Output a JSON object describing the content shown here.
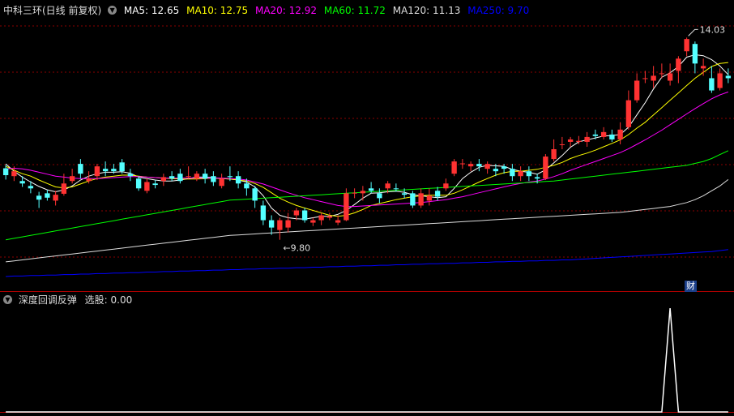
{
  "header": {
    "title": "中科三环(日线 前复权)",
    "ma": [
      {
        "label": "MA5: 12.65",
        "color": "#ffffff"
      },
      {
        "label": "MA10: 12.75",
        "color": "#ffff00"
      },
      {
        "label": "MA20: 12.92",
        "color": "#ff00ff"
      },
      {
        "label": "MA60: 11.72",
        "color": "#00ff00"
      },
      {
        "label": "MA120: 11.13",
        "color": "#dddddd"
      },
      {
        "label": "MA250: 9.70",
        "color": "#0000ff"
      }
    ]
  },
  "indicator": {
    "title": "深度回调反弹",
    "value_label": "选股: 0.00",
    "finance_badge": "财"
  },
  "colors": {
    "up": "#ff3232",
    "down": "#54ffff",
    "grid": "#8b0000"
  },
  "chart_data": {
    "type": "candlestick",
    "annotations": {
      "high_label": "14.03",
      "low_label": "9.80"
    },
    "ylim": [
      9.1,
      14.4
    ],
    "candles": [
      [
        11.36,
        11.22,
        11.43,
        11.13
      ],
      [
        11.2,
        11.3,
        11.4,
        11.1
      ],
      [
        11.1,
        11.05,
        11.2,
        10.98
      ],
      [
        11.0,
        10.95,
        11.1,
        10.85
      ],
      [
        10.8,
        10.72,
        10.88,
        10.55
      ],
      [
        10.85,
        10.76,
        10.92,
        10.7
      ],
      [
        10.7,
        10.82,
        10.9,
        10.6
      ],
      [
        10.84,
        11.05,
        11.25,
        10.8
      ],
      [
        11.1,
        11.2,
        11.35,
        11.05
      ],
      [
        11.45,
        11.25,
        11.55,
        11.15
      ],
      [
        11.1,
        11.15,
        11.3,
        11.05
      ],
      [
        11.2,
        11.4,
        11.45,
        11.12
      ],
      [
        11.35,
        11.3,
        11.5,
        11.2
      ],
      [
        11.35,
        11.3,
        11.45,
        11.25
      ],
      [
        11.48,
        11.3,
        11.55,
        11.25
      ],
      [
        11.25,
        11.2,
        11.35,
        11.1
      ],
      [
        11.15,
        10.95,
        11.2,
        10.9
      ],
      [
        10.9,
        11.08,
        11.15,
        10.85
      ],
      [
        11.05,
        11.02,
        11.12,
        10.95
      ],
      [
        11.1,
        11.18,
        11.25,
        11.0
      ],
      [
        11.2,
        11.15,
        11.3,
        11.1
      ],
      [
        11.25,
        11.1,
        11.35,
        11.05
      ],
      [
        11.2,
        11.2,
        11.4,
        11.15
      ],
      [
        11.15,
        11.25,
        11.3,
        11.1
      ],
      [
        11.25,
        11.15,
        11.35,
        11.05
      ],
      [
        11.2,
        11.08,
        11.3,
        11.0
      ],
      [
        11.0,
        11.15,
        11.25,
        10.95
      ],
      [
        11.2,
        11.18,
        11.4,
        11.1
      ],
      [
        11.2,
        11.05,
        11.3,
        10.95
      ],
      [
        11.05,
        10.95,
        11.15,
        10.8
      ],
      [
        10.95,
        10.7,
        11.0,
        10.55
      ],
      [
        10.6,
        10.3,
        10.7,
        10.2
      ],
      [
        10.3,
        10.15,
        10.4,
        10.0
      ],
      [
        10.1,
        10.3,
        10.35,
        9.9
      ],
      [
        10.15,
        10.3,
        10.45,
        10.05
      ],
      [
        10.4,
        10.5,
        10.55,
        10.3
      ],
      [
        10.5,
        10.3,
        10.55,
        10.25
      ],
      [
        10.25,
        10.3,
        10.35,
        10.18
      ],
      [
        10.3,
        10.4,
        10.45,
        10.2
      ],
      [
        10.35,
        10.38,
        10.45,
        10.3
      ],
      [
        10.25,
        10.3,
        10.4,
        10.2
      ],
      [
        10.3,
        10.85,
        10.95,
        10.28
      ],
      [
        10.85,
        10.86,
        10.95,
        10.75
      ],
      [
        10.85,
        10.9,
        11.0,
        10.7
      ],
      [
        10.95,
        10.9,
        11.08,
        10.85
      ],
      [
        10.85,
        10.75,
        10.95,
        10.65
      ],
      [
        10.95,
        11.05,
        11.1,
        10.85
      ],
      [
        10.95,
        10.94,
        11.05,
        10.88
      ],
      [
        10.85,
        10.82,
        10.95,
        10.75
      ],
      [
        10.85,
        10.6,
        10.9,
        10.55
      ],
      [
        10.6,
        10.85,
        10.95,
        10.55
      ],
      [
        10.7,
        10.8,
        10.95,
        10.6
      ],
      [
        10.9,
        10.78,
        10.98,
        10.7
      ],
      [
        10.95,
        11.05,
        11.15,
        10.9
      ],
      [
        11.25,
        11.5,
        11.55,
        11.2
      ],
      [
        11.45,
        11.46,
        11.55,
        11.35
      ],
      [
        11.4,
        11.45,
        11.5,
        11.3
      ],
      [
        11.45,
        11.4,
        11.55,
        11.3
      ],
      [
        11.35,
        11.45,
        11.5,
        11.25
      ],
      [
        11.35,
        11.3,
        11.45,
        11.2
      ],
      [
        11.4,
        11.35,
        11.45,
        11.25
      ],
      [
        11.35,
        11.2,
        11.45,
        11.1
      ],
      [
        11.2,
        11.3,
        11.4,
        11.1
      ],
      [
        11.3,
        11.2,
        11.4,
        11.1
      ],
      [
        11.18,
        11.15,
        11.25,
        11.05
      ],
      [
        11.15,
        11.6,
        11.65,
        11.12
      ],
      [
        11.55,
        11.75,
        11.95,
        11.5
      ],
      [
        11.85,
        11.85,
        12.0,
        11.75
      ],
      [
        11.9,
        11.95,
        12.0,
        11.8
      ],
      [
        11.9,
        11.92,
        12.02,
        11.85
      ],
      [
        11.9,
        12.0,
        12.1,
        11.8
      ],
      [
        12.05,
        12.02,
        12.15,
        11.95
      ],
      [
        12.0,
        12.1,
        12.2,
        11.95
      ],
      [
        12.05,
        11.95,
        12.15,
        11.9
      ],
      [
        11.95,
        12.15,
        12.3,
        11.85
      ],
      [
        12.2,
        12.75,
        12.95,
        12.15
      ],
      [
        12.75,
        13.15,
        13.3,
        12.7
      ],
      [
        13.2,
        13.2,
        13.35,
        13.1
      ],
      [
        13.15,
        13.25,
        13.45,
        13.0
      ],
      [
        13.3,
        13.3,
        13.5,
        13.2
      ],
      [
        13.15,
        13.3,
        13.5,
        13.05
      ],
      [
        13.35,
        13.6,
        13.65,
        13.1
      ],
      [
        13.75,
        14.0,
        14.03,
        13.65
      ],
      [
        13.9,
        13.5,
        13.95,
        13.3
      ],
      [
        13.4,
        13.45,
        13.6,
        13.25
      ],
      [
        13.2,
        12.95,
        13.45,
        12.9
      ],
      [
        13.0,
        13.3,
        13.4,
        12.95
      ],
      [
        13.25,
        13.2,
        13.4,
        13.1
      ]
    ],
    "series": [
      {
        "name": "MA5",
        "values": [
          11.45,
          11.3,
          11.18,
          11.08,
          10.99,
          10.92,
          10.88,
          10.92,
          11.0,
          11.12,
          11.2,
          11.25,
          11.28,
          11.28,
          11.29,
          11.26,
          11.18,
          11.15,
          11.12,
          11.1,
          11.1,
          11.12,
          11.15,
          11.18,
          11.18,
          11.17,
          11.15,
          11.14,
          11.12,
          11.08,
          10.98,
          10.8,
          10.55,
          10.4,
          10.35,
          10.33,
          10.32,
          10.35,
          10.38,
          10.38,
          10.42,
          10.5,
          10.62,
          10.75,
          10.85,
          10.86,
          10.88,
          10.89,
          10.87,
          10.82,
          10.8,
          10.78,
          10.76,
          10.78,
          10.95,
          11.15,
          11.28,
          11.38,
          11.42,
          11.41,
          11.4,
          11.34,
          11.3,
          11.28,
          11.24,
          11.33,
          11.47,
          11.62,
          11.79,
          11.9,
          11.94,
          11.98,
          12.02,
          12.03,
          12.05,
          12.2,
          12.45,
          12.7,
          12.98,
          13.22,
          13.31,
          13.44,
          13.63,
          13.68,
          13.66,
          13.58,
          13.45,
          13.27
        ]
      },
      {
        "name": "MA10",
        "values": [
          11.4,
          11.32,
          11.25,
          11.2,
          11.12,
          11.05,
          10.98,
          10.96,
          10.98,
          11.04,
          11.1,
          11.15,
          11.18,
          11.2,
          11.22,
          11.22,
          11.2,
          11.18,
          11.17,
          11.16,
          11.15,
          11.14,
          11.14,
          11.14,
          11.15,
          11.16,
          11.15,
          11.14,
          11.12,
          11.1,
          11.05,
          10.97,
          10.86,
          10.75,
          10.67,
          10.6,
          10.55,
          10.5,
          10.45,
          10.4,
          10.38,
          10.4,
          10.45,
          10.52,
          10.6,
          10.64,
          10.68,
          10.72,
          10.75,
          10.78,
          10.8,
          10.81,
          10.81,
          10.81,
          10.85,
          10.92,
          11.0,
          11.08,
          11.15,
          11.22,
          11.27,
          11.3,
          11.3,
          11.32,
          11.34,
          11.38,
          11.42,
          11.48,
          11.56,
          11.62,
          11.67,
          11.73,
          11.8,
          11.87,
          11.94,
          12.05,
          12.18,
          12.3,
          12.45,
          12.6,
          12.75,
          12.9,
          13.05,
          13.2,
          13.32,
          13.44,
          13.5,
          13.52
        ]
      },
      {
        "name": "MA20",
        "values": [
          11.35,
          11.36,
          11.35,
          11.32,
          11.28,
          11.24,
          11.2,
          11.18,
          11.16,
          11.15,
          11.15,
          11.15,
          11.16,
          11.17,
          11.18,
          11.19,
          11.19,
          11.18,
          11.17,
          11.16,
          11.16,
          11.16,
          11.16,
          11.16,
          11.16,
          11.16,
          11.16,
          11.15,
          11.14,
          11.12,
          11.08,
          11.04,
          10.98,
          10.92,
          10.86,
          10.81,
          10.76,
          10.72,
          10.68,
          10.64,
          10.6,
          10.58,
          10.58,
          10.59,
          10.6,
          10.61,
          10.62,
          10.63,
          10.64,
          10.65,
          10.66,
          10.68,
          10.7,
          10.72,
          10.75,
          10.78,
          10.82,
          10.86,
          10.9,
          10.94,
          10.98,
          11.02,
          11.05,
          11.08,
          11.1,
          11.14,
          11.19,
          11.25,
          11.32,
          11.38,
          11.44,
          11.5,
          11.56,
          11.62,
          11.68,
          11.76,
          11.85,
          11.94,
          12.04,
          12.14,
          12.25,
          12.36,
          12.47,
          12.58,
          12.68,
          12.78,
          12.86,
          12.92
        ]
      },
      {
        "name": "MA60",
        "values": [
          9.9,
          9.93,
          9.96,
          9.99,
          10.02,
          10.05,
          10.08,
          10.11,
          10.14,
          10.17,
          10.2,
          10.23,
          10.26,
          10.29,
          10.32,
          10.35,
          10.38,
          10.41,
          10.44,
          10.47,
          10.5,
          10.53,
          10.56,
          10.59,
          10.62,
          10.65,
          10.68,
          10.71,
          10.72,
          10.73,
          10.74,
          10.75,
          10.76,
          10.77,
          10.78,
          10.79,
          10.8,
          10.81,
          10.82,
          10.83,
          10.84,
          10.85,
          10.86,
          10.87,
          10.88,
          10.89,
          10.9,
          10.91,
          10.92,
          10.93,
          10.94,
          10.95,
          10.96,
          10.97,
          10.98,
          10.99,
          11.0,
          11.01,
          11.02,
          11.03,
          11.04,
          11.05,
          11.06,
          11.07,
          11.08,
          11.09,
          11.1,
          11.12,
          11.14,
          11.16,
          11.18,
          11.2,
          11.22,
          11.24,
          11.26,
          11.28,
          11.3,
          11.32,
          11.34,
          11.36,
          11.38,
          11.4,
          11.42,
          11.46,
          11.5,
          11.56,
          11.64,
          11.72
        ]
      },
      {
        "name": "MA120",
        "values": [
          9.45,
          9.47,
          9.49,
          9.51,
          9.53,
          9.55,
          9.57,
          9.59,
          9.61,
          9.63,
          9.65,
          9.67,
          9.69,
          9.71,
          9.73,
          9.75,
          9.77,
          9.79,
          9.81,
          9.83,
          9.85,
          9.87,
          9.89,
          9.91,
          9.93,
          9.95,
          9.97,
          9.99,
          10.0,
          10.01,
          10.02,
          10.03,
          10.04,
          10.05,
          10.06,
          10.07,
          10.08,
          10.09,
          10.1,
          10.11,
          10.12,
          10.13,
          10.14,
          10.15,
          10.16,
          10.17,
          10.18,
          10.19,
          10.2,
          10.21,
          10.22,
          10.23,
          10.24,
          10.25,
          10.26,
          10.27,
          10.28,
          10.29,
          10.3,
          10.31,
          10.32,
          10.33,
          10.34,
          10.35,
          10.36,
          10.37,
          10.38,
          10.39,
          10.4,
          10.41,
          10.42,
          10.43,
          10.44,
          10.45,
          10.46,
          10.48,
          10.5,
          10.52,
          10.54,
          10.56,
          10.58,
          10.62,
          10.66,
          10.72,
          10.8,
          10.9,
          11.0,
          11.13
        ]
      },
      {
        "name": "MA250",
        "values": [
          9.15,
          9.16,
          9.16,
          9.17,
          9.17,
          9.18,
          9.18,
          9.19,
          9.19,
          9.2,
          9.2,
          9.21,
          9.21,
          9.22,
          9.22,
          9.23,
          9.23,
          9.24,
          9.24,
          9.25,
          9.25,
          9.26,
          9.26,
          9.27,
          9.27,
          9.28,
          9.28,
          9.29,
          9.29,
          9.3,
          9.3,
          9.31,
          9.31,
          9.32,
          9.32,
          9.33,
          9.33,
          9.34,
          9.34,
          9.35,
          9.35,
          9.36,
          9.36,
          9.37,
          9.37,
          9.38,
          9.38,
          9.39,
          9.39,
          9.4,
          9.4,
          9.41,
          9.41,
          9.42,
          9.42,
          9.43,
          9.43,
          9.44,
          9.44,
          9.45,
          9.45,
          9.46,
          9.46,
          9.47,
          9.47,
          9.48,
          9.48,
          9.49,
          9.49,
          9.5,
          9.51,
          9.52,
          9.53,
          9.54,
          9.55,
          9.56,
          9.57,
          9.58,
          9.59,
          9.6,
          9.61,
          9.62,
          9.63,
          9.64,
          9.65,
          9.66,
          9.68,
          9.7
        ]
      }
    ],
    "signal": {
      "name": "选股",
      "ylim": [
        0,
        1
      ],
      "values": [
        0,
        0,
        0,
        0,
        0,
        0,
        0,
        0,
        0,
        0,
        0,
        0,
        0,
        0,
        0,
        0,
        0,
        0,
        0,
        0,
        0,
        0,
        0,
        0,
        0,
        0,
        0,
        0,
        0,
        0,
        0,
        0,
        0,
        0,
        0,
        0,
        0,
        0,
        0,
        0,
        0,
        0,
        0,
        0,
        0,
        0,
        0,
        0,
        0,
        0,
        0,
        0,
        0,
        0,
        0,
        0,
        0,
        0,
        0,
        0,
        0,
        0,
        0,
        0,
        0,
        0,
        0,
        0,
        0,
        0,
        0,
        0,
        0,
        0,
        0,
        0,
        0,
        0,
        0,
        0,
        1,
        0,
        0,
        0,
        0,
        0,
        0,
        0
      ]
    }
  }
}
